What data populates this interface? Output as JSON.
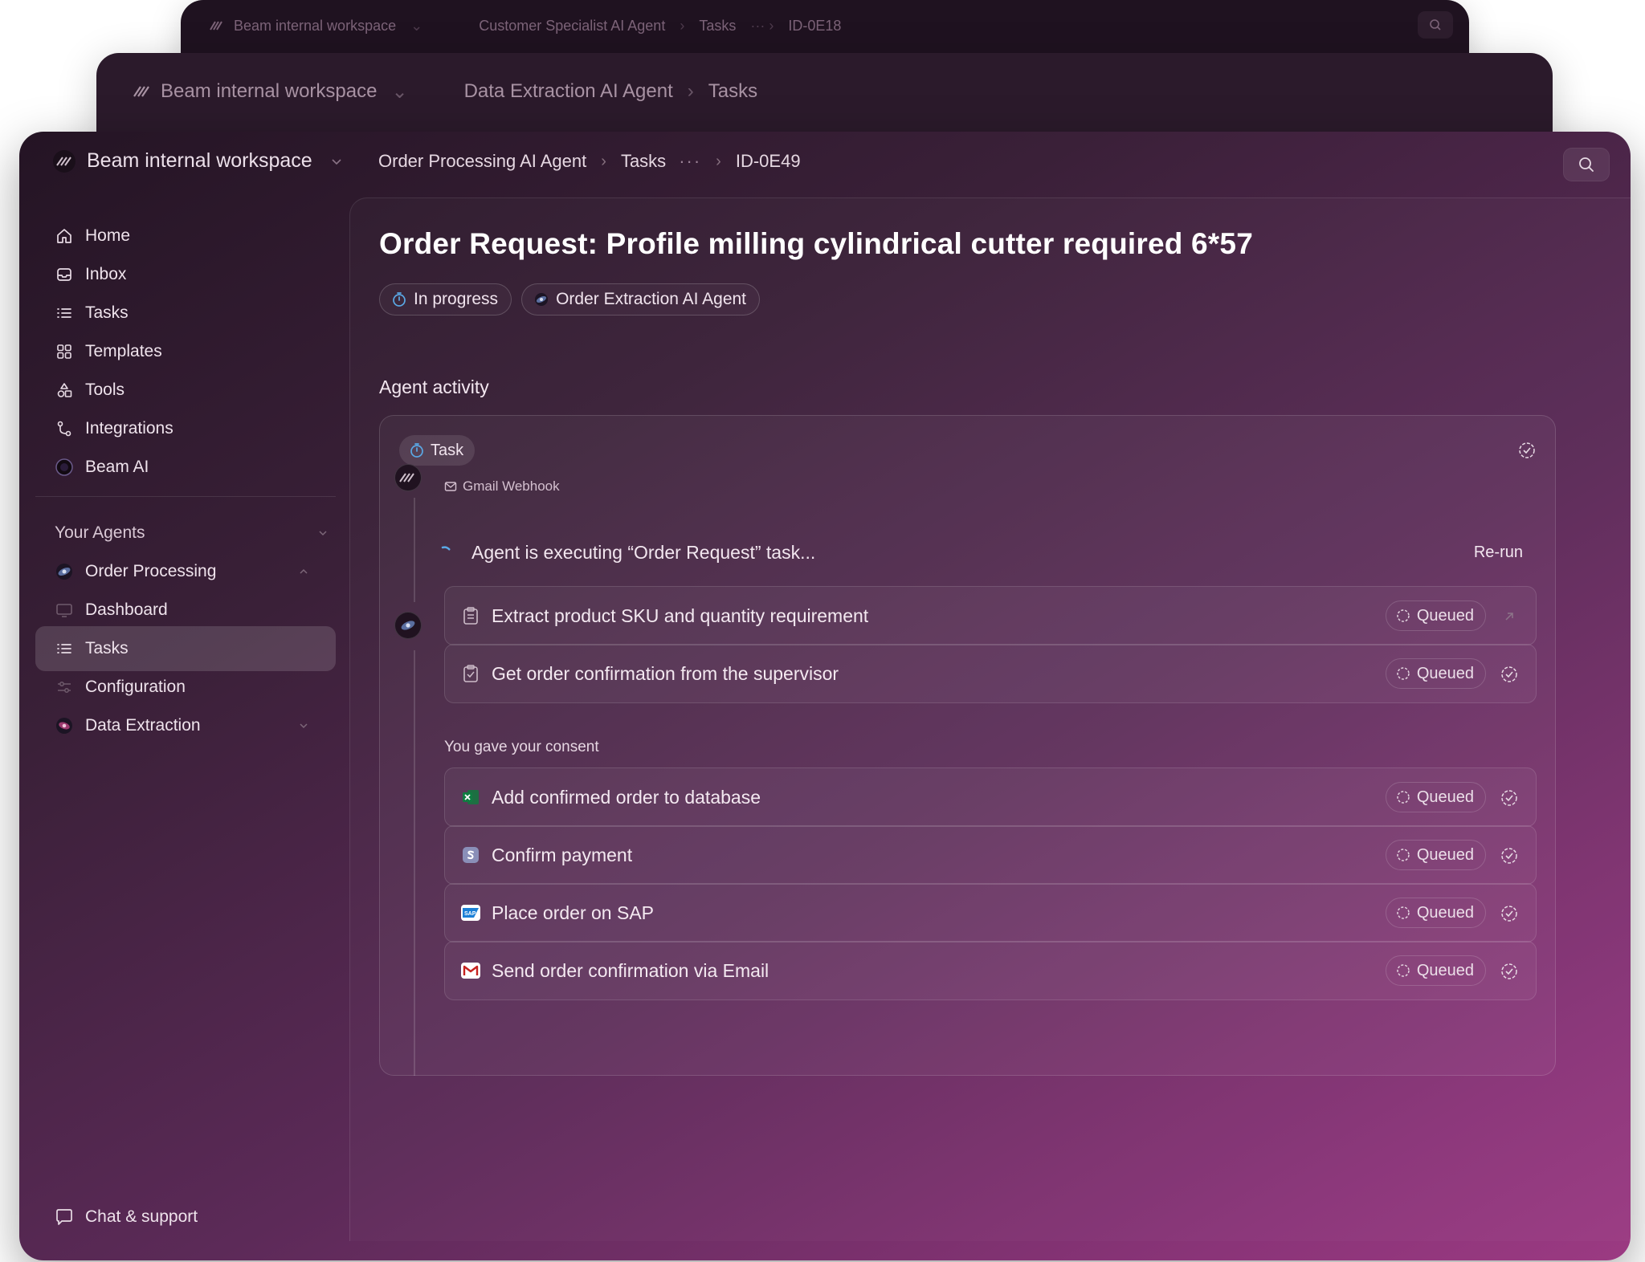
{
  "back_window": {
    "workspace": "Beam internal workspace",
    "breadcrumb": [
      "Customer Specialist AI Agent",
      "Tasks",
      "ID-0E18"
    ]
  },
  "mid_window": {
    "workspace": "Beam internal workspace",
    "breadcrumb": [
      "Data Extraction AI Agent",
      "Tasks"
    ]
  },
  "header": {
    "workspace": "Beam internal workspace",
    "breadcrumb": {
      "agent": "Order Processing AI Agent",
      "section": "Tasks",
      "more": "···",
      "id": "ID-0E49"
    }
  },
  "sidebar": {
    "items": [
      {
        "label": "Home",
        "icon": "home-icon"
      },
      {
        "label": "Inbox",
        "icon": "inbox-icon"
      },
      {
        "label": "Tasks",
        "icon": "list-icon"
      },
      {
        "label": "Templates",
        "icon": "grid-icon"
      },
      {
        "label": "Tools",
        "icon": "shapes-icon"
      },
      {
        "label": "Integrations",
        "icon": "git-branch-icon"
      },
      {
        "label": "Beam AI",
        "icon": "beam-logo-icon"
      }
    ],
    "agents_section": "Your Agents",
    "agents": [
      {
        "label": "Order Processing",
        "icon": "agent-avatar-icon"
      },
      {
        "label": "Dashboard",
        "icon": "monitor-icon"
      },
      {
        "label": "Tasks",
        "icon": "list-icon",
        "active": true
      },
      {
        "label": "Configuration",
        "icon": "sliders-icon"
      },
      {
        "label": "Data Extraction",
        "icon": "agent-avatar-icon"
      }
    ],
    "footer": "Chat & support"
  },
  "task": {
    "title": "Order Request: Profile milling cylindrical cutter required 6*57",
    "status": "In progress",
    "agent_chip": "Order Extraction AI Agent",
    "activity_heading": "Agent activity",
    "task_chip": "Task",
    "source": "Gmail Webhook",
    "executing_text": "Agent  is executing “Order Request” task...",
    "rerun": "Re-run",
    "consent": "You gave your consent",
    "queued_label": "Queued",
    "steps": [
      {
        "label": "Extract product SKU and quantity requirement",
        "status": "Queued",
        "icon": "clipboard-icon"
      },
      {
        "label": "Get order confirmation from the supervisor",
        "status": "Queued",
        "icon": "clipboard-check-icon"
      },
      {
        "label": "Add confirmed order to database",
        "status": "Queued",
        "icon": "excel-icon"
      },
      {
        "label": "Confirm payment",
        "status": "Queued",
        "icon": "stripe-icon"
      },
      {
        "label": "Place order on SAP",
        "status": "Queued",
        "icon": "sap-icon"
      },
      {
        "label": "Send order confirmation via Email",
        "status": "Queued",
        "icon": "gmail-icon"
      }
    ]
  },
  "colors": {
    "accent": "#9b3a82",
    "dark": "#241424",
    "status_blue": "#5aa9e6"
  }
}
